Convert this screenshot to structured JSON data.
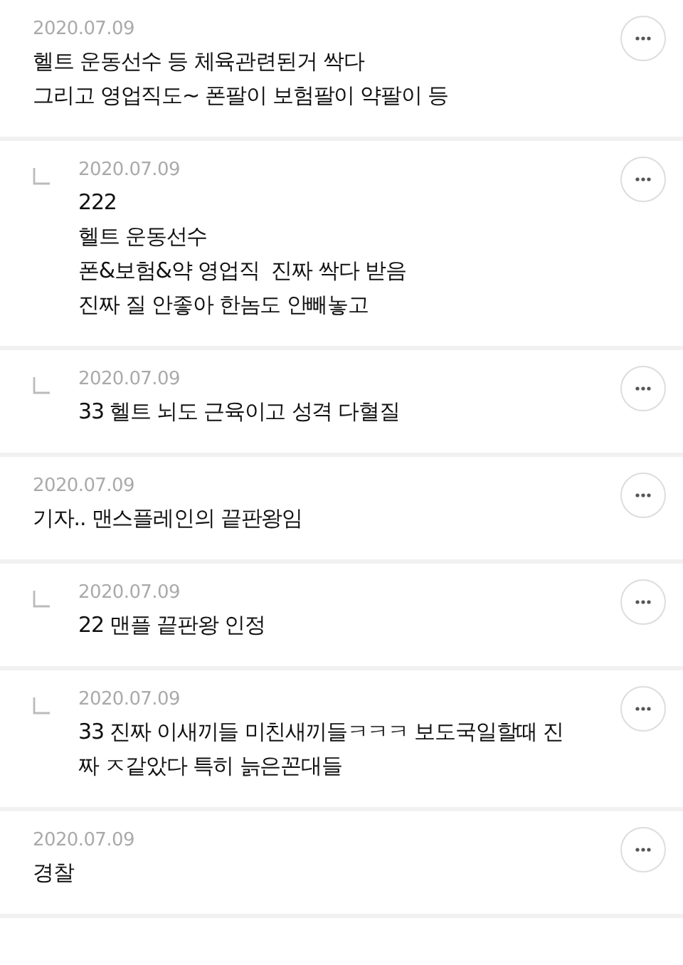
{
  "comments": [
    {
      "kind": "comment",
      "date": "2020.07.09",
      "text": "헬트 운동선수 등 체육관련된거 싹다\n그리고 영업직도~ 폰팔이 보험팔이 약팔이 등"
    },
    {
      "kind": "reply",
      "date": "2020.07.09",
      "text": "222\n헬트 운동선수\n폰&보험&약 영업직  진짜 싹다 받음\n진짜 질 안좋아 한놈도 안빼놓고"
    },
    {
      "kind": "reply",
      "date": "2020.07.09",
      "text": "33 헬트 뇌도 근육이고 성격 다혈질"
    },
    {
      "kind": "comment",
      "date": "2020.07.09",
      "text": "기자.. 맨스플레인의 끝판왕임"
    },
    {
      "kind": "reply",
      "date": "2020.07.09",
      "text": "22 맨플 끝판왕 인정"
    },
    {
      "kind": "reply",
      "date": "2020.07.09",
      "text": "33 진짜 이새끼들 미친새끼들ㅋㅋㅋ 보도국일할때 진\n짜 ㅈ같았다 특히 늙은꼰대들"
    },
    {
      "kind": "comment",
      "date": "2020.07.09",
      "text": "경찰"
    }
  ]
}
